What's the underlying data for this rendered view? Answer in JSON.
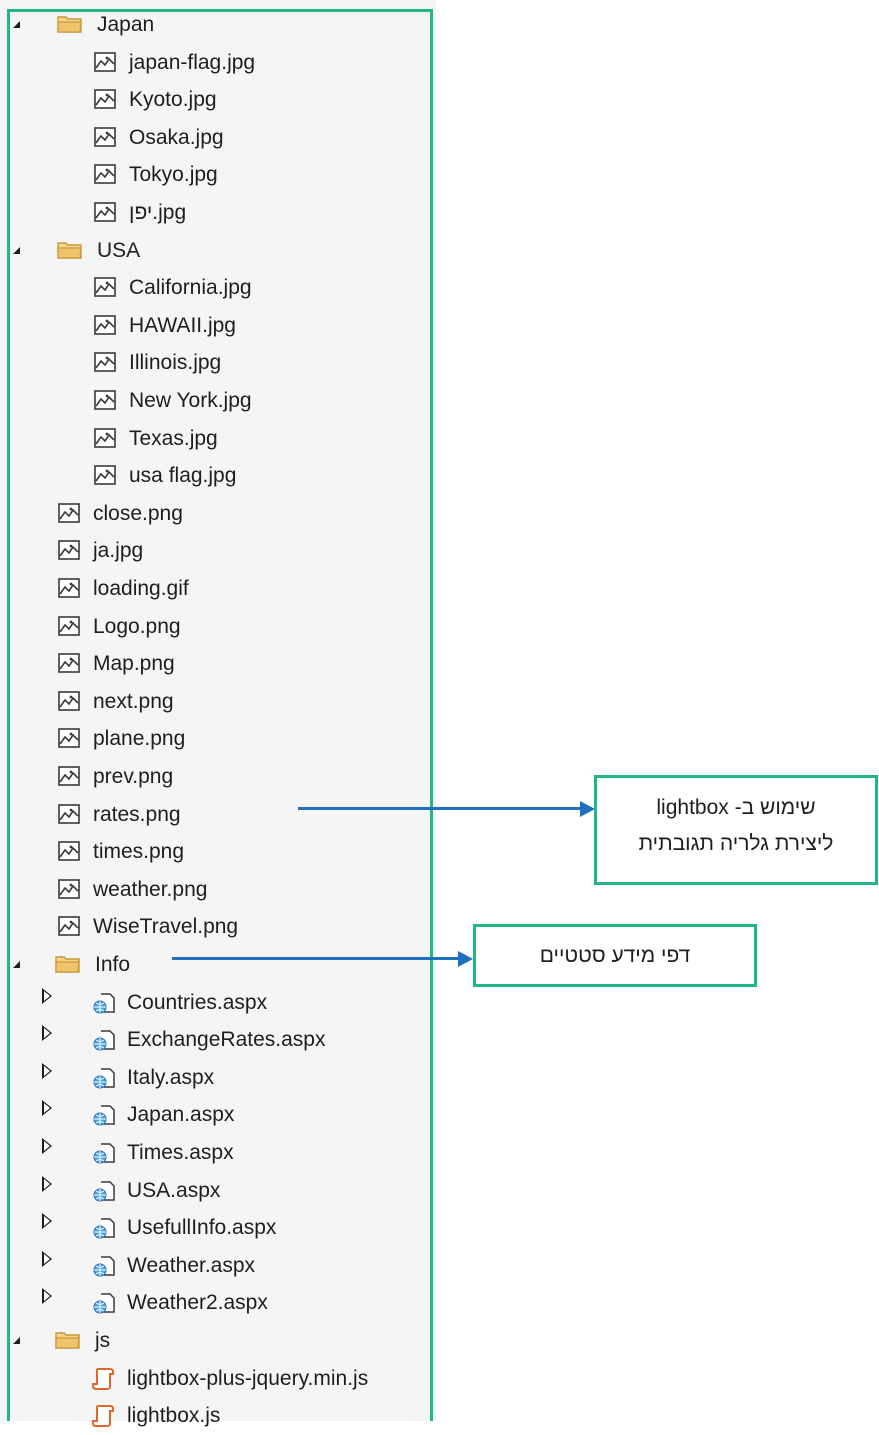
{
  "tree": [
    {
      "type": "folder",
      "label": "Japan",
      "depth": 1,
      "toggle": "open"
    },
    {
      "type": "image",
      "label": "japan-flag.jpg",
      "depth": 2
    },
    {
      "type": "image",
      "label": "Kyoto.jpg",
      "depth": 2
    },
    {
      "type": "image",
      "label": "Osaka.jpg",
      "depth": 2
    },
    {
      "type": "image",
      "label": "Tokyo.jpg",
      "depth": 2
    },
    {
      "type": "image",
      "label": "יפן.jpg",
      "depth": 2
    },
    {
      "type": "folder",
      "label": "USA",
      "depth": 1,
      "toggle": "open"
    },
    {
      "type": "image",
      "label": "California.jpg",
      "depth": 2
    },
    {
      "type": "image",
      "label": "HAWAII.jpg",
      "depth": 2
    },
    {
      "type": "image",
      "label": "Illinois.jpg",
      "depth": 2
    },
    {
      "type": "image",
      "label": "New York.jpg",
      "depth": 2
    },
    {
      "type": "image",
      "label": "Texas.jpg",
      "depth": 2
    },
    {
      "type": "image",
      "label": "usa flag.jpg",
      "depth": 2
    },
    {
      "type": "image",
      "label": "close.png",
      "depth": 1
    },
    {
      "type": "image",
      "label": "ja.jpg",
      "depth": 1
    },
    {
      "type": "image",
      "label": "loading.gif",
      "depth": 1
    },
    {
      "type": "image",
      "label": "Logo.png",
      "depth": 1
    },
    {
      "type": "image",
      "label": "Map.png",
      "depth": 1
    },
    {
      "type": "image",
      "label": "next.png",
      "depth": 1
    },
    {
      "type": "image",
      "label": "plane.png",
      "depth": 1
    },
    {
      "type": "image",
      "label": "prev.png",
      "depth": 1
    },
    {
      "type": "image",
      "label": "rates.png",
      "depth": 1
    },
    {
      "type": "image",
      "label": "times.png",
      "depth": 1
    },
    {
      "type": "image",
      "label": "weather.png",
      "depth": 1
    },
    {
      "type": "image",
      "label": "WiseTravel.png",
      "depth": 1
    },
    {
      "type": "folder",
      "label": "Info",
      "depth": 0,
      "toggle": "open"
    },
    {
      "type": "aspx",
      "label": "Countries.aspx",
      "depth": 1,
      "toggle": "closed"
    },
    {
      "type": "aspx",
      "label": "ExchangeRates.aspx",
      "depth": 1,
      "toggle": "closed"
    },
    {
      "type": "aspx",
      "label": "Italy.aspx",
      "depth": 1,
      "toggle": "closed"
    },
    {
      "type": "aspx",
      "label": "Japan.aspx",
      "depth": 1,
      "toggle": "closed"
    },
    {
      "type": "aspx",
      "label": "Times.aspx",
      "depth": 1,
      "toggle": "closed"
    },
    {
      "type": "aspx",
      "label": "USA.aspx",
      "depth": 1,
      "toggle": "closed"
    },
    {
      "type": "aspx",
      "label": "UsefullInfo.aspx",
      "depth": 1,
      "toggle": "closed"
    },
    {
      "type": "aspx",
      "label": "Weather.aspx",
      "depth": 1,
      "toggle": "closed"
    },
    {
      "type": "aspx",
      "label": "Weather2.aspx",
      "depth": 1,
      "toggle": "closed"
    },
    {
      "type": "folder",
      "label": "js",
      "depth": 0,
      "toggle": "open"
    },
    {
      "type": "js",
      "label": "lightbox-plus-jquery.min.js",
      "depth": 1
    },
    {
      "type": "js",
      "label": "lightbox.js",
      "depth": 1
    }
  ],
  "callouts": {
    "info_note": "דפי מידע סטטיים",
    "js_note_line1": "שימוש ב- lightbox",
    "js_note_line2": "ליצירת  גלריה תגובתית"
  },
  "colors": {
    "accent": "#1fb885",
    "arrow": "#1f6fbf",
    "folder": "#f0c36d"
  }
}
